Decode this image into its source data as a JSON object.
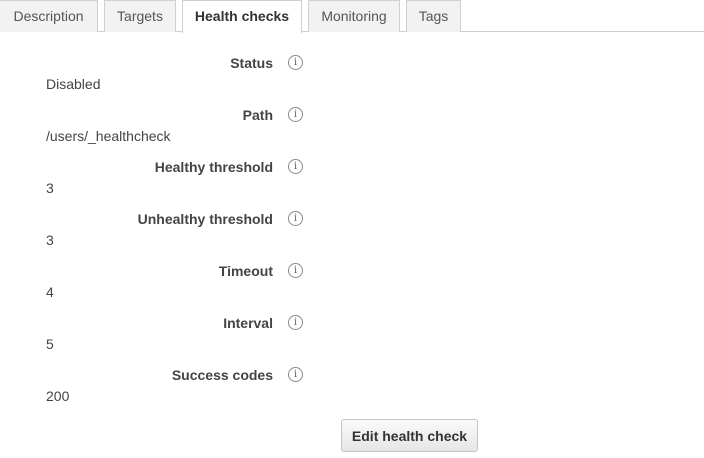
{
  "tabs": [
    {
      "label": "Description"
    },
    {
      "label": "Targets"
    },
    {
      "label": "Health checks",
      "active": true
    },
    {
      "label": "Monitoring"
    },
    {
      "label": "Tags"
    }
  ],
  "fields": [
    {
      "label": "Status",
      "value": "Disabled"
    },
    {
      "label": "Path",
      "value": "/users/_healthcheck"
    },
    {
      "label": "Healthy threshold",
      "value": "3"
    },
    {
      "label": "Unhealthy threshold",
      "value": "3"
    },
    {
      "label": "Timeout",
      "value": "4"
    },
    {
      "label": "Interval",
      "value": "5"
    },
    {
      "label": "Success codes",
      "value": "200"
    }
  ],
  "icons": {
    "info": "info-icon"
  },
  "info_glyph": "i",
  "actions": {
    "edit_label": "Edit health check"
  },
  "colors": {
    "text": "#444444",
    "border": "#cfcfcf",
    "tab_background": "#f2f2f2"
  }
}
